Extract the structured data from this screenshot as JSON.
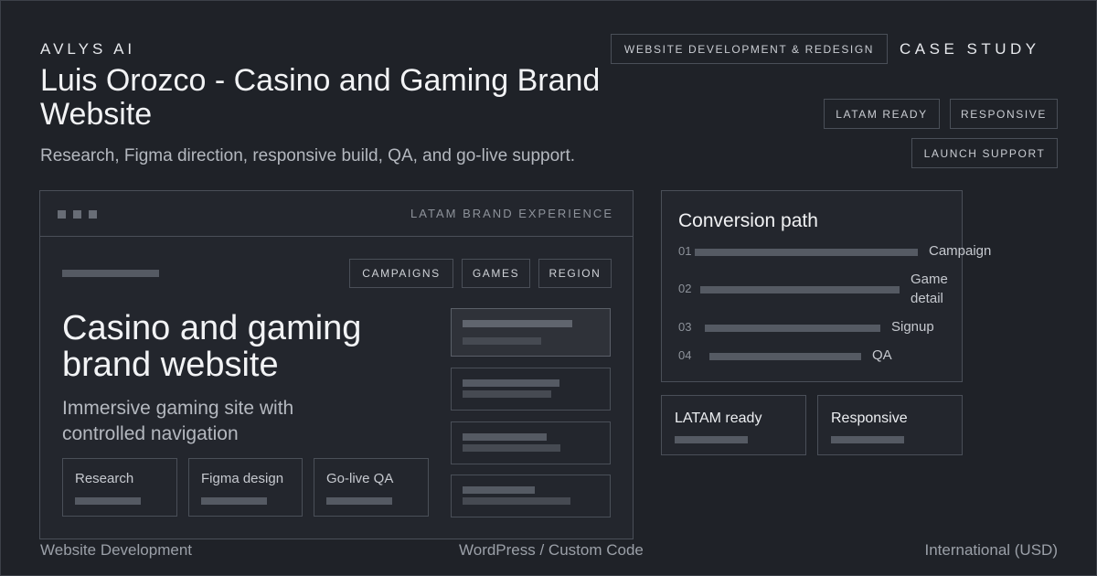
{
  "header": {
    "brand": "AVLYS AI",
    "category_tag": "WEBSITE DEVELOPMENT & REDESIGN",
    "case_study": "CASE STUDY",
    "title": "Luis Orozco - Casino and Gaming Brand Website",
    "subtitle": "Research, Figma direction, responsive build, QA, and go-live support.",
    "tags": [
      "LATAM READY",
      "RESPONSIVE",
      "LAUNCH SUPPORT"
    ]
  },
  "mockup": {
    "label": "LATAM BRAND EXPERIENCE",
    "nav": [
      "CAMPAIGNS",
      "GAMES",
      "REGION"
    ],
    "hero_title": "Casino and gaming brand website",
    "hero_subtitle": "Immersive gaming site with controlled navigation",
    "cards": [
      "Research",
      "Figma design",
      "Go-live QA"
    ]
  },
  "conversion": {
    "title": "Conversion path",
    "steps": [
      {
        "num": "01",
        "label": "Campaign"
      },
      {
        "num": "02",
        "label": "Game detail"
      },
      {
        "num": "03",
        "label": "Signup"
      },
      {
        "num": "04",
        "label": "QA"
      }
    ]
  },
  "cards": [
    "LATAM ready",
    "Responsive"
  ],
  "footer": {
    "left": "Website Development",
    "center": "WordPress / Custom Code",
    "right": "International (USD)"
  },
  "colors": {
    "background": "#1f2228",
    "border": "#4a4f58",
    "text": "#e9ebef",
    "muted": "#9ba0a8"
  }
}
